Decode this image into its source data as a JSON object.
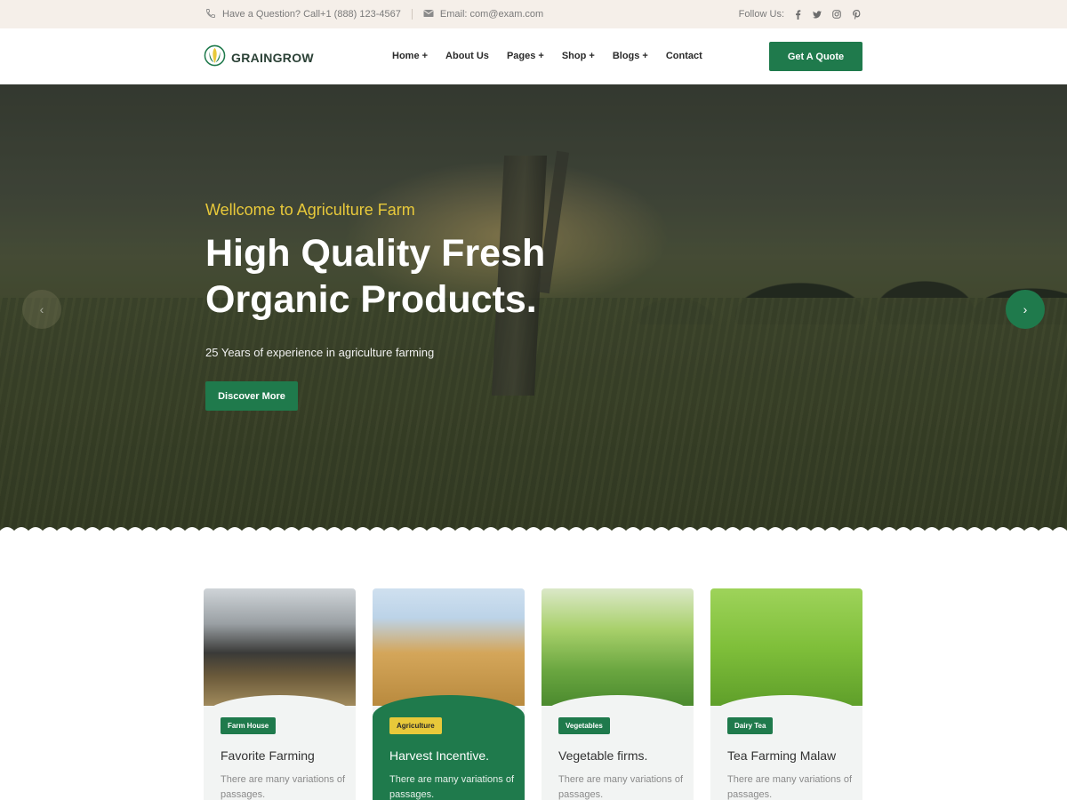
{
  "topbar": {
    "phone_text": "Have a Question? Call+1 (888) 123-4567",
    "email_text": "Email: com@exam.com",
    "follow_label": "Follow Us:",
    "social_icons": [
      "facebook-icon",
      "twitter-icon",
      "instagram-icon",
      "pinterest-icon"
    ]
  },
  "header": {
    "logo_text": "GRAINGROW",
    "nav": [
      "Home +",
      "About Us",
      "Pages +",
      "Shop +",
      "Blogs +",
      "Contact"
    ],
    "cta_label": "Get A Quote"
  },
  "hero": {
    "subtitle": "Wellcome to Agriculture Farm",
    "title_line1": "High Quality Fresh",
    "title_line2": "Organic Products.",
    "description": "25 Years of experience in agriculture farming",
    "button_label": "Discover More",
    "prev_arrow": "‹",
    "next_arrow": "›"
  },
  "cards": [
    {
      "tag": "Farm House",
      "title": "Favorite Farming",
      "desc": "There are many variations of passages."
    },
    {
      "tag": "Agriculture",
      "title": "Harvest Incentive.",
      "desc": "There are many variations of passages."
    },
    {
      "tag": "Vegetables",
      "title": "Vegetable firms.",
      "desc": "There are many variations of passages."
    },
    {
      "tag": "Dairy Tea",
      "title": "Tea Farming Malaw",
      "desc": "There are many variations of passages."
    }
  ],
  "colors": {
    "primary": "#1f7a4c",
    "accent": "#e8c93a",
    "topbar_bg": "#f5efe9"
  }
}
